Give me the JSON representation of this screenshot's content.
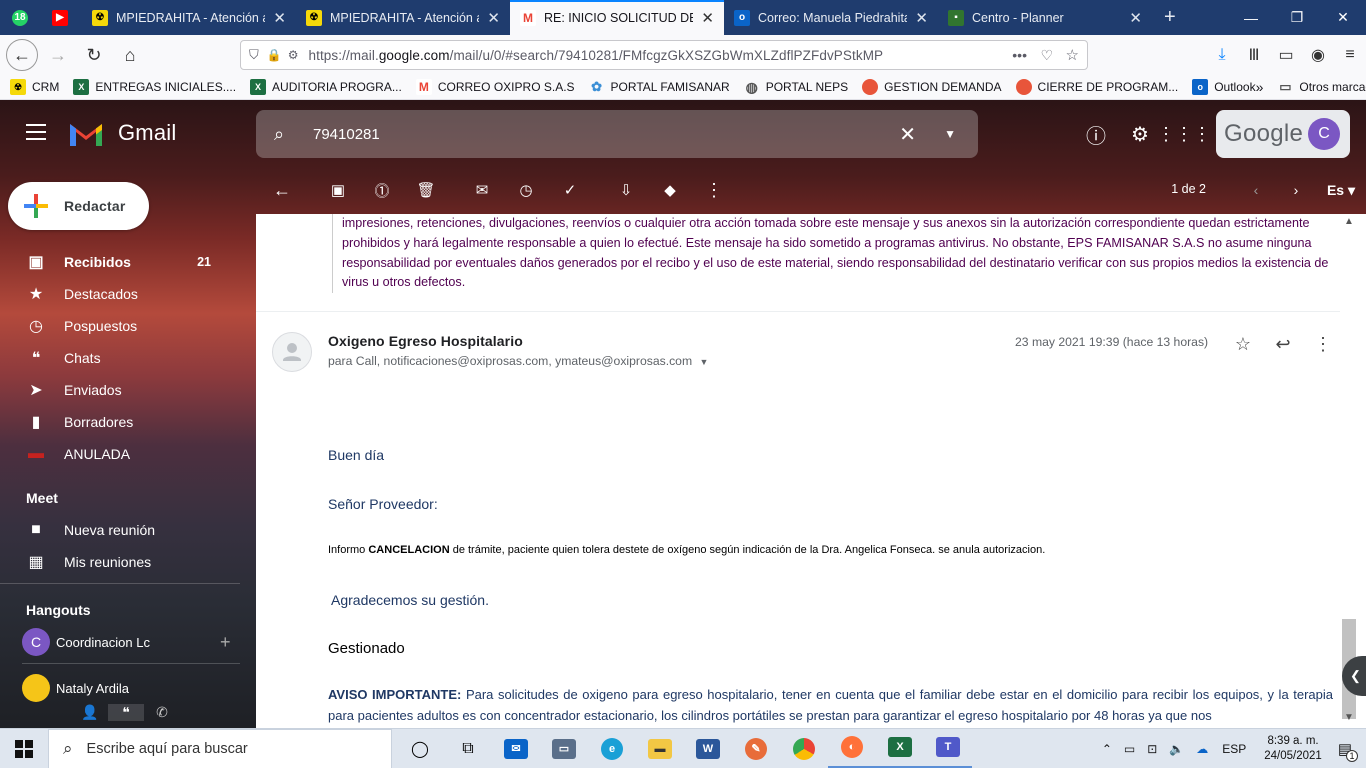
{
  "browser": {
    "tabs": [
      {
        "title": "MPIEDRAHITA - Atención al U",
        "icon": "yellow-alert-icon"
      },
      {
        "title": "MPIEDRAHITA - Atención al U",
        "icon": "yellow-alert-icon"
      },
      {
        "title": "RE: INICIO SOLICITUD DE OXÍ",
        "icon": "gmail-icon",
        "active": true
      },
      {
        "title": "Correo: Manuela Piedrahita -",
        "icon": "outlook-icon"
      },
      {
        "title": "Centro - Planner",
        "icon": "planner-icon"
      }
    ],
    "pinned_badge": "18",
    "url_prefix": "https://mail.",
    "url_domain": "google.com",
    "url_rest": "/mail/u/0/#search/79410281/FMfcgzGkXSZGbWmXLZdflPZFdvPStkMP",
    "bookmarks": [
      {
        "label": "CRM",
        "color": "#e8c21a"
      },
      {
        "label": "ENTREGAS INICIALES....",
        "color": "#1d6f42"
      },
      {
        "label": "AUDITORIA PROGRA...",
        "color": "#1d6f42"
      },
      {
        "label": "CORREO OXIPRO S.A.S",
        "color": "#ea4335"
      },
      {
        "label": "PORTAL FAMISANAR",
        "color": "#3b8fd6"
      },
      {
        "label": "PORTAL NEPS",
        "color": "#555555"
      },
      {
        "label": "GESTION DEMANDA",
        "color": "#e8553a"
      },
      {
        "label": "CIERRE DE PROGRAM...",
        "color": "#e8553a"
      },
      {
        "label": "Outlook",
        "color": "#0a64c8"
      }
    ],
    "other_bookmarks": "Otros marcadores"
  },
  "gmail": {
    "app_name": "Gmail",
    "search_value": "79410281",
    "google_label": "Google",
    "avatar_letter": "C",
    "compose": "Redactar",
    "nav": [
      {
        "label": "Recibidos",
        "count": "21",
        "icon": "inbox-icon",
        "bold": true
      },
      {
        "label": "Destacados",
        "icon": "star-icon"
      },
      {
        "label": "Pospuestos",
        "icon": "clock-icon"
      },
      {
        "label": "Chats",
        "icon": "chat-icon"
      },
      {
        "label": "Enviados",
        "icon": "send-icon"
      },
      {
        "label": "Borradores",
        "icon": "draft-icon"
      },
      {
        "label": "ANULADA",
        "icon": "label-icon"
      }
    ],
    "meet_title": "Meet",
    "meet": [
      {
        "label": "Nueva reunión",
        "icon": "video-icon"
      },
      {
        "label": "Mis reuniones",
        "icon": "calendar-icon"
      }
    ],
    "hangouts_title": "Hangouts",
    "hangouts": [
      {
        "name": "Coordinacion Lc",
        "letter": "C"
      },
      {
        "name": "Nataly Ardila"
      }
    ],
    "pager": "1 de 2",
    "lang": "Es",
    "quote_text": "impresiones, retenciones, divulgaciones, reenvíos o cualquier otra acción tomada sobre este mensaje y sus anexos sin la autorización correspondiente quedan estrictamente prohibidos y hará legalmente responsable a quien lo efectué. Este mensaje ha sido sometido a programas antivirus. No obstante, EPS FAMISANAR S.A.S no asume ninguna responsabilidad por eventuales daños generados por el recibo y el uso de este material, siendo responsabilidad del destinatario verificar con sus propios medios la existencia de virus u otros defectos.",
    "message": {
      "sender": "Oxigeno Egreso Hospitalario",
      "recipients": "para Call, notificaciones@oxiprosas.com, ymateus@oxiprosas.com",
      "date": "23 may 2021 19:39 (hace 13 horas)",
      "greeting": "Buen día",
      "salutation": "Señor Proveedor:",
      "inform_prefix": "Informo ",
      "inform_bold": "CANCELACION",
      "inform_rest": " de trámite, paciente quien tolera destete de oxígeno según indicación de la Dra. Angelica Fonseca.  se anula autorizacion.",
      "thanks": "Agradecemos su gestión.",
      "status": "Gestionado",
      "notice_bold": "AVISO IMPORTANTE:",
      "notice_text": " Para solicitudes de oxigeno para egreso hospitalario, tener en cuenta que el familiar debe estar en el domicilio para recibir los equipos, y la terapia para pacientes adultos es con concentrador estacionario, los cilindros portátiles se prestan para garantizar el egreso hospitalario por 48 horas ya que nos"
    }
  },
  "taskbar": {
    "search_placeholder": "Escribe aquí para buscar",
    "lang": "ESP",
    "time": "8:39 a. m.",
    "date": "24/05/2021",
    "notification_count": "1"
  }
}
